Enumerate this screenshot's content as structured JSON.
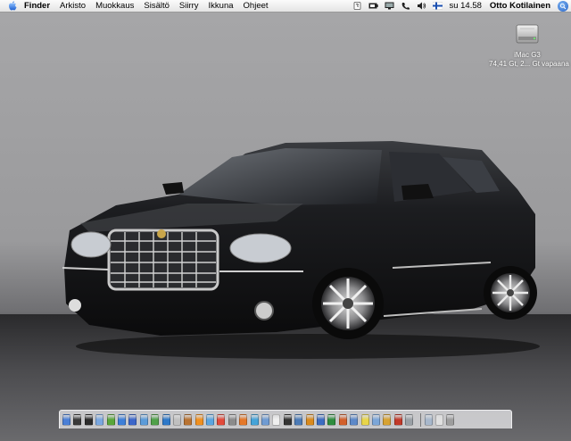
{
  "menubar": {
    "app_name": "Finder",
    "menus": [
      "Arkisto",
      "Muokkaus",
      "Sisältö",
      "Siirry",
      "Ikkuna",
      "Ohjeet"
    ],
    "status_icons": [
      "script-icon",
      "battery-icon",
      "display-icon",
      "phone-icon",
      "volume-icon",
      "finnish-flag-icon"
    ],
    "clock": "su 14.58",
    "user": "Otto Kotilainen"
  },
  "desktop": {
    "drive_name": "iMac G3",
    "drive_info": "74,41 Gt, 2... Gt vapaana"
  },
  "dock": {
    "apps": [
      {
        "name": "finder-icon",
        "color": "#4a7fd6"
      },
      {
        "name": "dashboard-icon",
        "color": "#3a3a3a"
      },
      {
        "name": "hyperlink-icon",
        "color": "#2b2b2b"
      },
      {
        "name": "mail-icon",
        "color": "#7aa7e0"
      },
      {
        "name": "ichat-icon",
        "color": "#59a63a"
      },
      {
        "name": "safari-icon",
        "color": "#3e7fd8"
      },
      {
        "name": "itunes-icon",
        "color": "#3c66c9"
      },
      {
        "name": "iphoto-icon",
        "color": "#5c9bd8"
      },
      {
        "name": "imovie-icon",
        "color": "#50a04a"
      },
      {
        "name": "globe-icon",
        "color": "#2e78c8"
      },
      {
        "name": "garageband-icon",
        "color": "#c0c0c0"
      },
      {
        "name": "addressbook-icon",
        "color": "#b87333"
      },
      {
        "name": "vlc-icon",
        "color": "#f09020"
      },
      {
        "name": "preview-icon",
        "color": "#5ba5e0"
      },
      {
        "name": "ical-icon",
        "color": "#e24a3b"
      },
      {
        "name": "system-prefs-icon",
        "color": "#8b8b8b"
      },
      {
        "name": "firefox-icon",
        "color": "#e4782a"
      },
      {
        "name": "messenger-icon",
        "color": "#45a3d8"
      },
      {
        "name": "quicktime-icon",
        "color": "#6f9bd2"
      },
      {
        "name": "textedit-icon",
        "color": "#efefef"
      },
      {
        "name": "terminal-icon",
        "color": "#333333"
      },
      {
        "name": "photoshop-icon",
        "color": "#4c7bb6"
      },
      {
        "name": "illustrator-icon",
        "color": "#d98a1d"
      },
      {
        "name": "word-icon",
        "color": "#3b6cc1"
      },
      {
        "name": "excel-icon",
        "color": "#2e8c3e"
      },
      {
        "name": "powerpoint-icon",
        "color": "#d2602c"
      },
      {
        "name": "entourage-icon",
        "color": "#5c88c8"
      },
      {
        "name": "stickies-icon",
        "color": "#e8d54a"
      },
      {
        "name": "keynote-icon",
        "color": "#7ca6d8"
      },
      {
        "name": "pages-icon",
        "color": "#d7a232"
      },
      {
        "name": "acrobat-icon",
        "color": "#c23a2a"
      },
      {
        "name": "utility-icon",
        "color": "#9aa0a6"
      }
    ],
    "trailing": [
      {
        "name": "folder-icon",
        "color": "#a8b8cc"
      },
      {
        "name": "document-icon",
        "color": "#e0e0e0"
      },
      {
        "name": "trash-icon",
        "color": "#9d9d9d"
      }
    ]
  }
}
